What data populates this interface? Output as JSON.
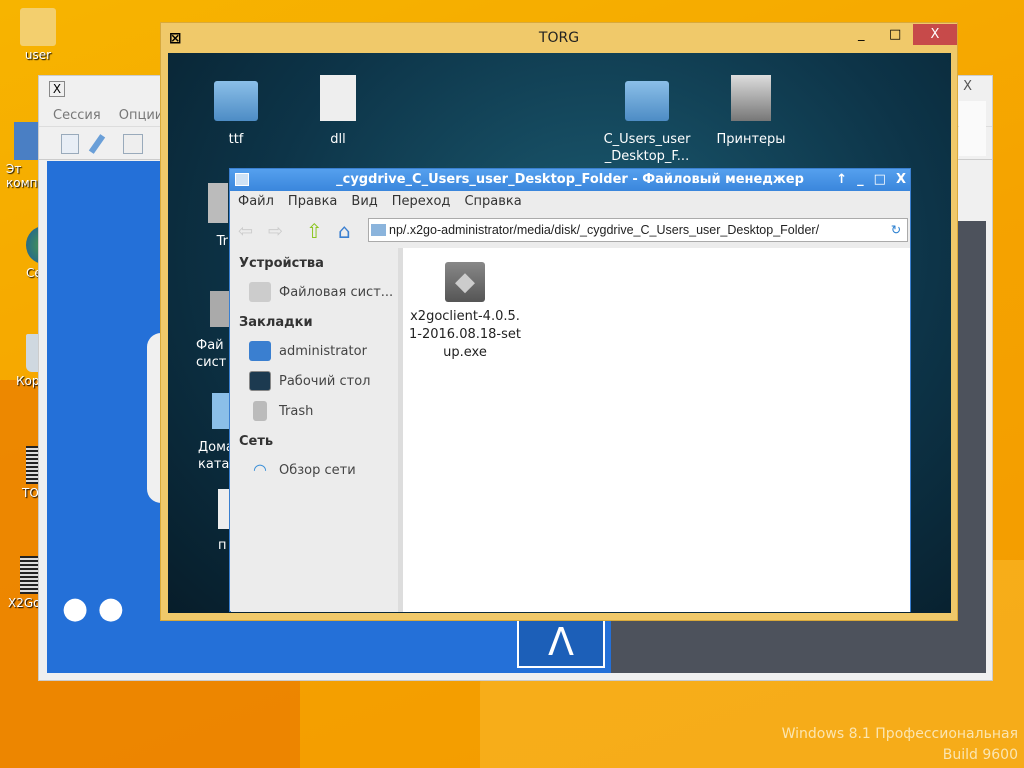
{
  "desktop": {
    "icons": [
      {
        "label": "user"
      },
      {
        "label": "Эт\nкомп"
      },
      {
        "label": "Се"
      },
      {
        "label": "Кор"
      },
      {
        "label": "TO"
      },
      {
        "label": "X2Go"
      }
    ],
    "watermark": [
      "Windows 8.1 Профессиональная",
      "Build 9600"
    ]
  },
  "x2go": {
    "menu": [
      "Сессия",
      "Опции"
    ],
    "close": "X"
  },
  "torg": {
    "title": "TORG",
    "controls": [
      "_",
      "□",
      "X"
    ],
    "icons": [
      {
        "label": "ttf"
      },
      {
        "label": "dll"
      },
      {
        "label": "C_Users_user _Desktop_F..."
      },
      {
        "label": "Принтеры"
      }
    ],
    "partial_icons": [
      "Tr",
      "Фай сист",
      "Дома ката",
      "п"
    ]
  },
  "fm": {
    "title": "_cygdrive_C_Users_user_Desktop_Folder - Файловый менеджер",
    "controls": [
      "↑",
      "_",
      "□",
      "X"
    ],
    "menu": [
      "Файл",
      "Правка",
      "Вид",
      "Переход",
      "Справка"
    ],
    "path": "np/.x2go-administrator/media/disk/_cygdrive_C_Users_user_Desktop_Folder/",
    "sidebar": {
      "devices_heading": "Устройства",
      "devices": [
        "Файловая сист..."
      ],
      "bookmarks_heading": "Закладки",
      "bookmarks": [
        "administrator",
        "Рабочий стол",
        "Trash"
      ],
      "network_heading": "Сеть",
      "network": [
        "Обзор сети"
      ]
    },
    "files": [
      {
        "name": "x2goclient-4.0.5.1-2016.08.18-setup.exe"
      }
    ]
  }
}
